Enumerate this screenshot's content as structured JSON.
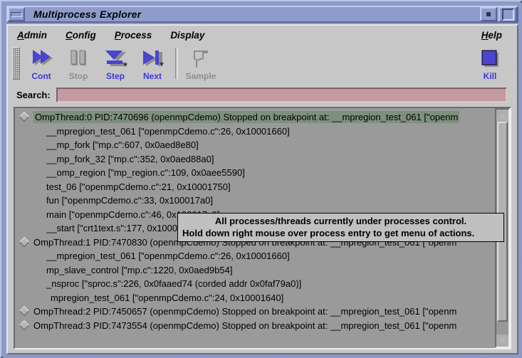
{
  "window": {
    "title": "Multiprocess Explorer",
    "menu_button_icon": "window-menu-icon",
    "minimize_icon": "minimize-icon",
    "maximize_icon": "maximize-icon"
  },
  "menubar": {
    "items": [
      {
        "label": "Admin",
        "mnemonic": "A",
        "rest": "dmin"
      },
      {
        "label": "Config",
        "mnemonic": "C",
        "rest": "onfig"
      },
      {
        "label": "Process",
        "mnemonic": "P",
        "rest": "rocess"
      },
      {
        "label": "Display",
        "mnemonic": "",
        "rest": "Display"
      }
    ],
    "help": {
      "label": "Help",
      "mnemonic": "H",
      "rest": "elp"
    }
  },
  "toolbar": {
    "grip_icon": "drag-handle-icon",
    "buttons": [
      {
        "label": "Cont",
        "icon": "fast-forward-icon",
        "enabled": true
      },
      {
        "label": "Stop",
        "icon": "pause-icon",
        "enabled": false
      },
      {
        "label": "Step",
        "icon": "step-into-icon",
        "enabled": true
      },
      {
        "label": "Next",
        "icon": "step-over-icon",
        "enabled": true
      },
      {
        "label": "Sample",
        "icon": "flag-icon",
        "enabled": false
      }
    ],
    "kill": {
      "label": "Kill",
      "icon": "stop-square-icon",
      "enabled": true
    }
  },
  "search": {
    "label": "Search:",
    "value": "",
    "placeholder": "",
    "field_color": "#c39a9f"
  },
  "process_list": {
    "rows": [
      {
        "type": "thread",
        "selected": true,
        "indent": 0,
        "text": "OmpThread:0  PID:7470696  (openmpCdemo)  Stopped on breakpoint at:  __mpregion_test_061 [\"openm"
      },
      {
        "type": "frame",
        "selected": false,
        "indent": 1,
        "text": "__mpregion_test_061 [\"openmpCdemo.c\":26, 0x10001660]"
      },
      {
        "type": "frame",
        "selected": false,
        "indent": 1,
        "text": "__mp_fork [\"mp.c\":607, 0x0aed8e80]"
      },
      {
        "type": "frame",
        "selected": false,
        "indent": 1,
        "text": "__mp_fork_32 [\"mp.c\":352, 0x0aed88a0]"
      },
      {
        "type": "frame",
        "selected": false,
        "indent": 1,
        "text": "__omp_region [\"mp_region.c\":109, 0x0aee5590]"
      },
      {
        "type": "frame",
        "selected": false,
        "indent": 1,
        "text": "test_06 [\"openmpCdemo.c\":21, 0x10001750]"
      },
      {
        "type": "frame",
        "selected": false,
        "indent": 1,
        "text": "fun [\"openmpCdemo.c\":33, 0x100017a0]"
      },
      {
        "type": "frame",
        "selected": false,
        "indent": 1,
        "text": "main [\"openmpCdemo.c\":46, 0x100017c0]"
      },
      {
        "type": "frame",
        "selected": false,
        "indent": 1,
        "text": "__start [\"crt1text.s\":177, 0x100012b8]"
      },
      {
        "type": "thread",
        "selected": false,
        "indent": 0,
        "text": "OmpThread:1  PID:7470830  (openmpCdemo)  Stopped on breakpoint at:  __mpregion_test_061 [\"openm"
      },
      {
        "type": "frame",
        "selected": false,
        "indent": 1,
        "text": "__mpregion_test_061 [\"openmpCdemo.c\":26, 0x10001660]"
      },
      {
        "type": "frame",
        "selected": false,
        "indent": 1,
        "text": "mp_slave_control [\"mp.c\":1220, 0x0aed9b54]"
      },
      {
        "type": "frame",
        "selected": false,
        "indent": 1,
        "text": "_nsproc [\"sproc.s\":226, 0x0faaed74 (corded addr 0x0faf79a0)]"
      },
      {
        "type": "frame",
        "selected": false,
        "indent": 2,
        "text": "mpregion_test_061 [\"openmpCdemo.c\":24, 0x10001640]"
      },
      {
        "type": "thread",
        "selected": false,
        "indent": 0,
        "text": "OmpThread:2  PID:7450657  (openmpCdemo)  Stopped on breakpoint at:  __mpregion_test_061 [\"openm"
      },
      {
        "type": "thread",
        "selected": false,
        "indent": 0,
        "text": "OmpThread:3  PID:7473554  (openmpCdemo)  Stopped on breakpoint at:  __mpregion_test_061 [\"openm"
      }
    ],
    "scrollbar": {
      "up_icon": "scroll-up-arrow-icon",
      "down_icon": "scroll-down-arrow-icon"
    }
  },
  "tooltip": {
    "line1": "All processes/threads currently under processes control.",
    "line2": "Hold down right mouse over process entry to get menu of actions."
  },
  "colors": {
    "frame": "#8b9acb",
    "client": "#c7c7c7",
    "list_bg": "#9a9a9a",
    "selection": "#7f8f7f",
    "accent_blue": "#3a3ad6",
    "disabled_gray": "#8e8e8e"
  }
}
